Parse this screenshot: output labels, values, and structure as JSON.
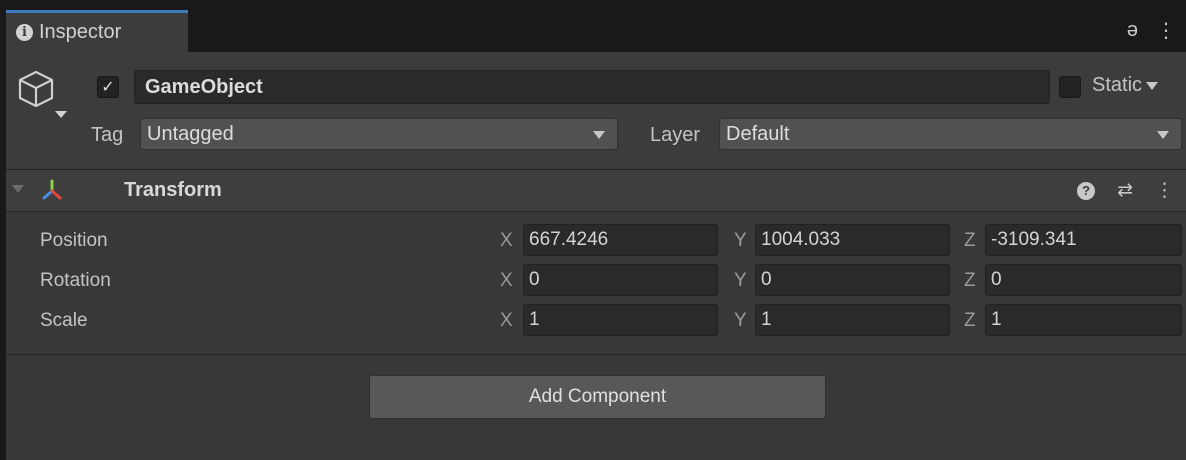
{
  "window": {
    "tab_title": "Inspector",
    "lock_glyph": "ə",
    "menu_glyph": "⋮"
  },
  "object": {
    "active": true,
    "name": "GameObject",
    "static_checked": false,
    "static_label": "Static",
    "tag_label": "Tag",
    "tag_value": "Untagged",
    "layer_label": "Layer",
    "layer_value": "Default"
  },
  "component": {
    "title": "Transform",
    "help_glyph": "?",
    "preset_glyph": "⇄",
    "menu_glyph": "⋮",
    "rows": [
      {
        "label": "Position",
        "x": "667.4246",
        "y": "1004.033",
        "z": "-3109.341"
      },
      {
        "label": "Rotation",
        "x": "0",
        "y": "0",
        "z": "0"
      },
      {
        "label": "Scale",
        "x": "1",
        "y": "1",
        "z": "1"
      }
    ],
    "axis_labels": {
      "x": "X",
      "y": "Y",
      "z": "Z"
    }
  },
  "footer": {
    "add_component_label": "Add Component"
  },
  "icons": {
    "info": "info-icon",
    "lock": "lock-icon",
    "menu": "kebab-menu-icon",
    "gameobject": "cube-icon",
    "transform": "transform-axes-icon",
    "help": "help-icon",
    "presets": "presets-icon"
  },
  "colors": {
    "tab_accent": "#3a79bb",
    "axis_x": "#e8453c",
    "axis_y": "#8fd14f",
    "axis_z": "#4a90e2"
  }
}
